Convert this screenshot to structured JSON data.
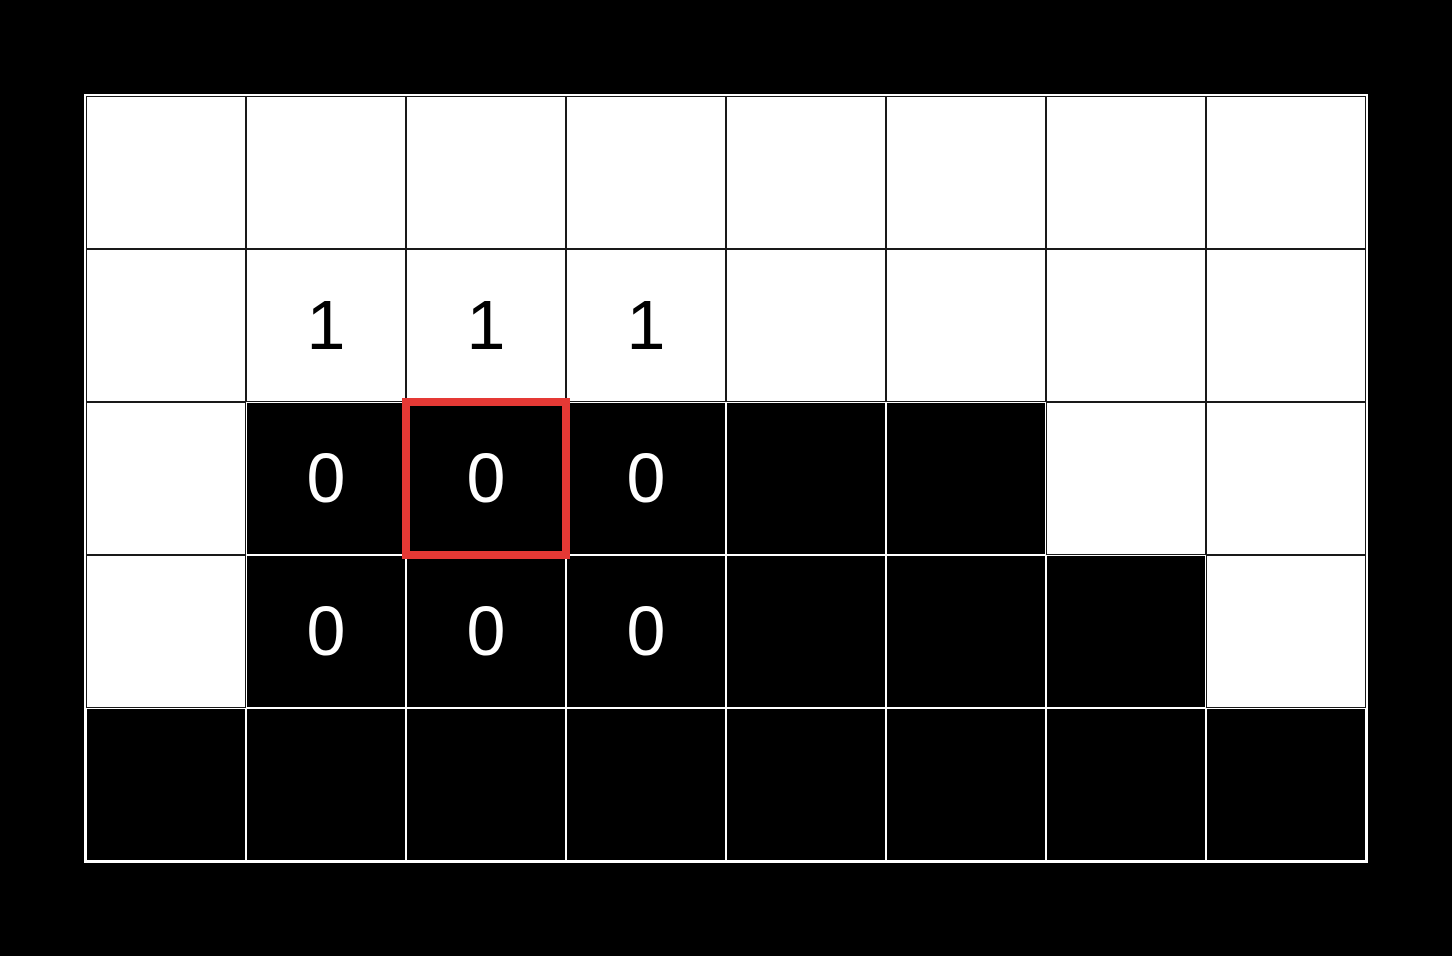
{
  "grid": {
    "rows": 5,
    "cols": 8,
    "highlight": {
      "row": 2,
      "col": 2
    },
    "cells": [
      [
        {
          "fill": "white",
          "value": ""
        },
        {
          "fill": "white",
          "value": ""
        },
        {
          "fill": "white",
          "value": ""
        },
        {
          "fill": "white",
          "value": ""
        },
        {
          "fill": "white",
          "value": ""
        },
        {
          "fill": "white",
          "value": ""
        },
        {
          "fill": "white",
          "value": ""
        },
        {
          "fill": "white",
          "value": ""
        }
      ],
      [
        {
          "fill": "white",
          "value": ""
        },
        {
          "fill": "white",
          "value": "1"
        },
        {
          "fill": "white",
          "value": "1"
        },
        {
          "fill": "white",
          "value": "1"
        },
        {
          "fill": "white",
          "value": ""
        },
        {
          "fill": "white",
          "value": ""
        },
        {
          "fill": "white",
          "value": ""
        },
        {
          "fill": "white",
          "value": ""
        }
      ],
      [
        {
          "fill": "white",
          "value": ""
        },
        {
          "fill": "black",
          "value": "0"
        },
        {
          "fill": "black",
          "value": "0"
        },
        {
          "fill": "black",
          "value": "0"
        },
        {
          "fill": "black",
          "value": ""
        },
        {
          "fill": "black",
          "value": ""
        },
        {
          "fill": "white",
          "value": ""
        },
        {
          "fill": "white",
          "value": ""
        }
      ],
      [
        {
          "fill": "white",
          "value": ""
        },
        {
          "fill": "black",
          "value": "0"
        },
        {
          "fill": "black",
          "value": "0"
        },
        {
          "fill": "black",
          "value": "0"
        },
        {
          "fill": "black",
          "value": ""
        },
        {
          "fill": "black",
          "value": ""
        },
        {
          "fill": "black",
          "value": ""
        },
        {
          "fill": "white",
          "value": ""
        }
      ],
      [
        {
          "fill": "black",
          "value": ""
        },
        {
          "fill": "black",
          "value": ""
        },
        {
          "fill": "black",
          "value": ""
        },
        {
          "fill": "black",
          "value": ""
        },
        {
          "fill": "black",
          "value": ""
        },
        {
          "fill": "black",
          "value": ""
        },
        {
          "fill": "black",
          "value": ""
        },
        {
          "fill": "black",
          "value": ""
        }
      ]
    ]
  }
}
